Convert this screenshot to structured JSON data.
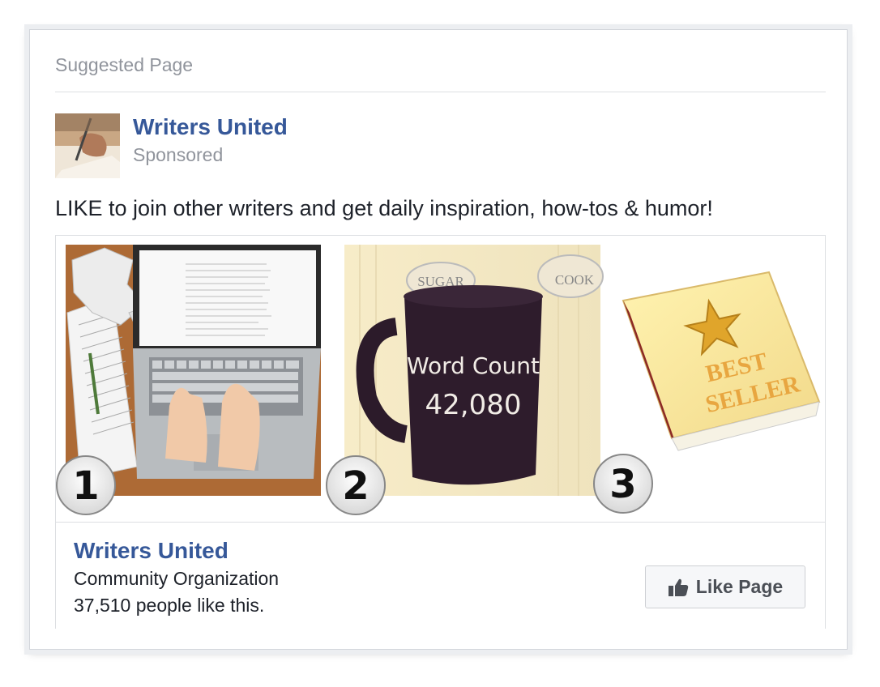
{
  "card": {
    "header": "Suggested Page"
  },
  "post": {
    "page_name": "Writers United",
    "sponsored_label": "Sponsored",
    "text": "LIKE to join other writers and get daily inspiration, how-tos & humor!"
  },
  "media": {
    "panels": [
      {
        "number": "1",
        "image": "laptop-typing-image"
      },
      {
        "number": "2",
        "image": "mug-image",
        "mug_text_line1": "Word Count",
        "mug_text_line2": "42,080",
        "canister_left": "SUGAR",
        "canister_right": "COOK"
      },
      {
        "number": "3",
        "image": "book-image",
        "book_text_line1": "BEST",
        "book_text_line2": "SELLER"
      }
    ]
  },
  "footer": {
    "page_name": "Writers United",
    "category": "Community Organization",
    "likes": "37,510 people like this.",
    "like_button_label": "Like Page",
    "like_icon": "thumbs-up-icon"
  },
  "colors": {
    "link": "#365899",
    "muted": "#90949c",
    "text": "#1d2129"
  }
}
